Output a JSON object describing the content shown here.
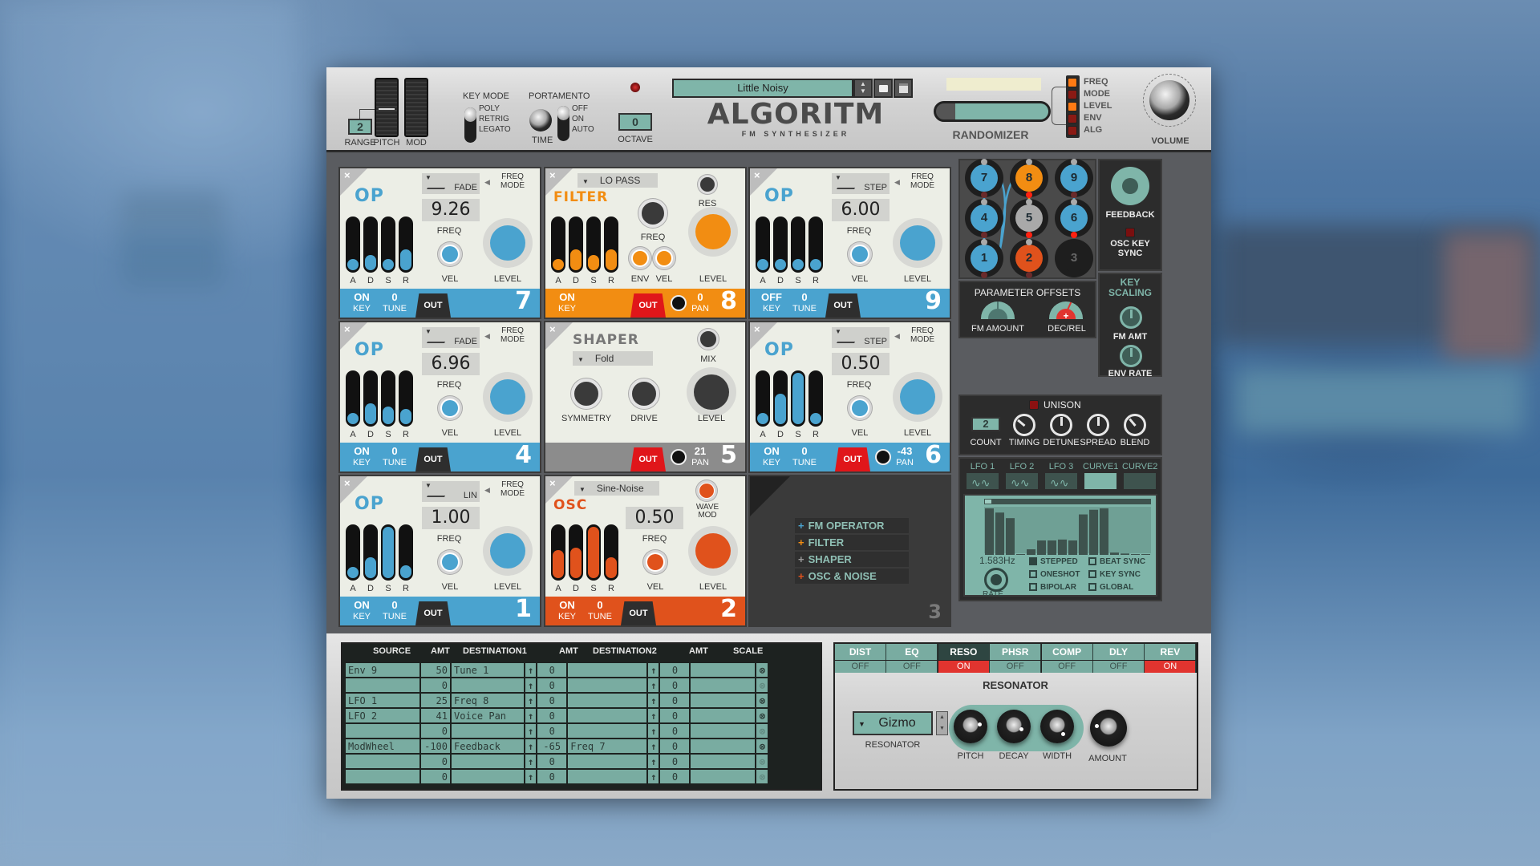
{
  "header": {
    "range_label": "RANGE",
    "range_value": "2",
    "pitch_label": "PITCH",
    "mod_label": "MOD",
    "key_mode_label": "KEY MODE",
    "key_mode_options": [
      "POLY",
      "RETRIG",
      "LEGATO"
    ],
    "portamento_label": "PORTAMENTO",
    "time_label": "TIME",
    "portamento_options": [
      "OFF",
      "ON",
      "AUTO"
    ],
    "octave_label": "OCTAVE",
    "octave_value": "0",
    "preset_name": "Little Noisy",
    "product_name": "ALGORITM",
    "product_subtitle": "FM SYNTHESIZER",
    "randomizer_label": "RANDOMIZER",
    "randomizer_amount": 0.83,
    "randomizer_targets": [
      {
        "label": "FREQ",
        "active": true
      },
      {
        "label": "MODE",
        "active": false
      },
      {
        "label": "LEVEL",
        "active": true
      },
      {
        "label": "ENV",
        "active": false
      },
      {
        "label": "ALG",
        "active": false
      }
    ],
    "volume_label": "VOLUME"
  },
  "colors": {
    "op_blue": "#4aa3cf",
    "filter_orange": "#f28d12",
    "osc_red": "#e0521c",
    "shaper_gray": "#8c8c8c",
    "teal": "#79aca1",
    "fx_on": "#e1342f"
  },
  "slots": [
    {
      "num": "7",
      "type": "op",
      "title": "OP",
      "mode": "FADE",
      "mode_label": "FREQ MODE",
      "freq": "9.26",
      "freq_label": "FREQ",
      "vel_label": "VEL",
      "level_label": "LEVEL",
      "adsr": [
        0.15,
        0.3,
        0.15,
        0.4
      ],
      "key": "ON",
      "key_label": "KEY",
      "tune": "0",
      "tune_label": "TUNE",
      "out": "OUT",
      "out_active": false
    },
    {
      "num": "8",
      "type": "filter",
      "title": "FILTER",
      "filter_type": "LO PASS",
      "res_label": "RES",
      "freq_label": "FREQ",
      "env_label": "ENV",
      "vel_label": "VEL",
      "level_label": "LEVEL",
      "adsr": [
        0.15,
        0.4,
        0.3,
        0.4
      ],
      "key": "ON",
      "key_label": "KEY",
      "pan": "0",
      "pan_label": "PAN",
      "out": "OUT",
      "out_active": true
    },
    {
      "num": "9",
      "type": "op",
      "title": "OP",
      "mode": "STEP",
      "mode_label": "FREQ MODE",
      "freq": "6.00",
      "freq_label": "FREQ",
      "vel_label": "VEL",
      "level_label": "LEVEL",
      "adsr": [
        0.15,
        0.15,
        0.15,
        0.15
      ],
      "key": "OFF",
      "key_label": "KEY",
      "tune": "0",
      "tune_label": "TUNE",
      "out": "OUT",
      "out_active": false
    },
    {
      "num": "4",
      "type": "op",
      "title": "OP",
      "mode": "FADE",
      "mode_label": "FREQ MODE",
      "freq": "6.96",
      "freq_label": "FREQ",
      "vel_label": "VEL",
      "level_label": "LEVEL",
      "adsr": [
        0.2,
        0.4,
        0.35,
        0.3
      ],
      "key": "ON",
      "key_label": "KEY",
      "tune": "0",
      "tune_label": "TUNE",
      "out": "OUT",
      "out_active": false
    },
    {
      "num": "5",
      "type": "shaper",
      "title": "SHAPER",
      "shape": "Fold",
      "mix_label": "MIX",
      "symmetry_label": "SYMMETRY",
      "drive_label": "DRIVE",
      "level_label": "LEVEL",
      "pan": "21",
      "pan_label": "PAN",
      "out": "OUT",
      "out_active": true
    },
    {
      "num": "6",
      "type": "op",
      "title": "OP",
      "mode": "STEP",
      "mode_label": "FREQ MODE",
      "freq": "0.50",
      "freq_label": "FREQ",
      "vel_label": "VEL",
      "level_label": "LEVEL",
      "adsr": [
        0.2,
        0.6,
        1.0,
        0.2
      ],
      "key": "ON",
      "key_label": "KEY",
      "tune": "0",
      "tune_label": "TUNE",
      "pan": "-43",
      "pan_label": "PAN",
      "out": "OUT",
      "out_active": true
    },
    {
      "num": "1",
      "type": "op",
      "title": "OP",
      "mode": "LIN",
      "mode_label": "FREQ MODE",
      "freq": "1.00",
      "freq_label": "FREQ",
      "vel_label": "VEL",
      "level_label": "LEVEL",
      "adsr": [
        0.15,
        0.4,
        1.0,
        0.25
      ],
      "key": "ON",
      "key_label": "KEY",
      "tune": "0",
      "tune_label": "TUNE",
      "out": "OUT",
      "out_active": false
    },
    {
      "num": "2",
      "type": "osc",
      "title": "OSC",
      "wave": "Sine-Noise",
      "wave_mod_label": "WAVE MOD",
      "freq": "0.50",
      "freq_label": "FREQ",
      "vel_label": "VEL",
      "level_label": "LEVEL",
      "adsr": [
        0.55,
        0.6,
        1.0,
        0.4
      ],
      "key": "ON",
      "key_label": "KEY",
      "tune": "0",
      "tune_label": "TUNE",
      "out": "OUT",
      "out_active": false
    },
    {
      "num": "3",
      "type": "empty",
      "add_menu": [
        {
          "label": "FM OPERATOR",
          "color": "#4aa3cf"
        },
        {
          "label": "FILTER",
          "color": "#f28d12"
        },
        {
          "label": "SHAPER",
          "color": "#9a9a9a"
        },
        {
          "label": "OSC & NOISE",
          "color": "#e0521c"
        }
      ]
    }
  ],
  "routing": {
    "nodes": [
      {
        "num": "7",
        "type": "op"
      },
      {
        "num": "8",
        "type": "filter"
      },
      {
        "num": "9",
        "type": "op"
      },
      {
        "num": "4",
        "type": "op"
      },
      {
        "num": "5",
        "type": "shaper"
      },
      {
        "num": "6",
        "type": "op"
      },
      {
        "num": "1",
        "type": "op"
      },
      {
        "num": "2",
        "type": "osc"
      },
      {
        "num": "3",
        "type": "empty"
      }
    ],
    "feedback_label": "FEEDBACK",
    "osc_key_sync_label": "OSC KEY SYNC",
    "key_scaling_label": "KEY SCALING",
    "fm_amt_label": "FM AMT",
    "env_rate_label": "ENV RATE",
    "param_offsets_label": "PARAMETER OFFSETS",
    "fm_amount_label": "FM AMOUNT",
    "dec_rel_label": "DEC/REL"
  },
  "unison": {
    "label": "UNISON",
    "count": "2",
    "count_label": "COUNT",
    "knobs": [
      "TIMING",
      "DETUNE",
      "SPREAD",
      "BLEND"
    ]
  },
  "lfo": {
    "tabs": [
      "LFO 1",
      "LFO 2",
      "LFO 3",
      "CURVE1",
      "CURVE2"
    ],
    "active_tab": "CURVE1",
    "rate_value": "1.583Hz",
    "rate_label": "RATE",
    "steps": [
      1.0,
      0.91,
      0.79,
      0,
      0.12,
      0.31,
      0.31,
      0.33,
      0.31,
      0.87,
      0.97,
      1.0,
      0.05,
      0.03,
      0.01,
      0
    ],
    "options": [
      {
        "label": "STEPPED",
        "checked": true
      },
      {
        "label": "BEAT SYNC",
        "checked": false
      },
      {
        "label": "ONESHOT",
        "checked": false
      },
      {
        "label": "KEY SYNC",
        "checked": false
      },
      {
        "label": "BIPOLAR",
        "checked": false
      },
      {
        "label": "GLOBAL",
        "checked": false
      }
    ]
  },
  "matrix": {
    "headers": [
      "SOURCE",
      "AMT",
      "DESTINATION1",
      "AMT",
      "DESTINATION2",
      "AMT",
      "SCALE"
    ],
    "rows": [
      {
        "source": "Env 9",
        "amt1": "50",
        "dest1": "Tune 1",
        "amt2": "0",
        "dest2": "",
        "amt3": "0",
        "scale": "",
        "active": true
      },
      {
        "source": "",
        "amt1": "0",
        "dest1": "",
        "amt2": "0",
        "dest2": "",
        "amt3": "0",
        "scale": "",
        "active": false
      },
      {
        "source": "LFO 1",
        "amt1": "25",
        "dest1": "Freq 8",
        "amt2": "0",
        "dest2": "",
        "amt3": "0",
        "scale": "",
        "active": true
      },
      {
        "source": "LFO 2",
        "amt1": "41",
        "dest1": "Voice Pan",
        "amt2": "0",
        "dest2": "",
        "amt3": "0",
        "scale": "",
        "active": true
      },
      {
        "source": "",
        "amt1": "0",
        "dest1": "",
        "amt2": "0",
        "dest2": "",
        "amt3": "0",
        "scale": "",
        "active": false
      },
      {
        "source": "ModWheel",
        "amt1": "-100",
        "dest1": "Feedback",
        "amt2": "-65",
        "dest2": "Freq 7",
        "amt3": "0",
        "scale": "",
        "active": true
      },
      {
        "source": "",
        "amt1": "0",
        "dest1": "",
        "amt2": "0",
        "dest2": "",
        "amt3": "0",
        "scale": "",
        "active": false
      },
      {
        "source": "",
        "amt1": "0",
        "dest1": "",
        "amt2": "0",
        "dest2": "",
        "amt3": "0",
        "scale": "",
        "active": false
      }
    ]
  },
  "effects": {
    "tabs": [
      {
        "label": "DIST",
        "state": "OFF"
      },
      {
        "label": "EQ",
        "state": "OFF"
      },
      {
        "label": "RESO",
        "state": "ON",
        "selected": true
      },
      {
        "label": "PHSR",
        "state": "OFF"
      },
      {
        "label": "COMP",
        "state": "OFF"
      },
      {
        "label": "DLY",
        "state": "OFF"
      },
      {
        "label": "REV",
        "state": "ON"
      }
    ],
    "section_title": "RESONATOR",
    "resonator_type": "Gizmo",
    "resonator_label": "RESONATOR",
    "knobs": [
      "PITCH",
      "DECAY",
      "WIDTH"
    ],
    "amount_label": "AMOUNT"
  }
}
